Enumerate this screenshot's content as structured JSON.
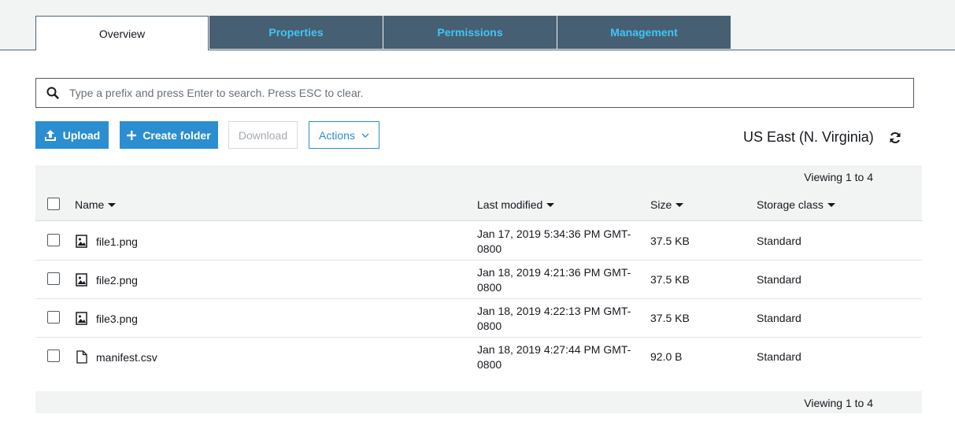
{
  "tabs": [
    {
      "label": "Overview",
      "active": true
    },
    {
      "label": "Properties",
      "active": false
    },
    {
      "label": "Permissions",
      "active": false
    },
    {
      "label": "Management",
      "active": false
    }
  ],
  "search": {
    "placeholder": "Type a prefix and press Enter to search. Press ESC to clear.",
    "value": ""
  },
  "toolbar": {
    "upload_label": "Upload",
    "create_folder_label": "Create folder",
    "download_label": "Download",
    "actions_label": "Actions"
  },
  "region": "US East (N. Virginia)",
  "pager": {
    "top_text": "Viewing 1 to 4",
    "bottom_text": "Viewing 1 to 4"
  },
  "table": {
    "columns": {
      "name": "Name",
      "modified": "Last modified",
      "size": "Size",
      "storage": "Storage class"
    },
    "rows": [
      {
        "icon": "image-file-icon",
        "name": "file1.png",
        "modified": "Jan 17, 2019 5:34:36 PM GMT-0800",
        "size": "37.5 KB",
        "storage": "Standard"
      },
      {
        "icon": "image-file-icon",
        "name": "file2.png",
        "modified": "Jan 18, 2019 4:21:36 PM GMT-0800",
        "size": "37.5 KB",
        "storage": "Standard"
      },
      {
        "icon": "image-file-icon",
        "name": "file3.png",
        "modified": "Jan 18, 2019 4:22:13 PM GMT-0800",
        "size": "37.5 KB",
        "storage": "Standard"
      },
      {
        "icon": "document-file-icon",
        "name": "manifest.csv",
        "modified": "Jan 18, 2019 4:27:44 PM GMT-0800",
        "size": "92.0 B",
        "storage": "Standard"
      }
    ]
  },
  "colors": {
    "accent": "#2b8ed0",
    "tab_bg": "#475f72",
    "tab_text": "#3fc6f7"
  }
}
